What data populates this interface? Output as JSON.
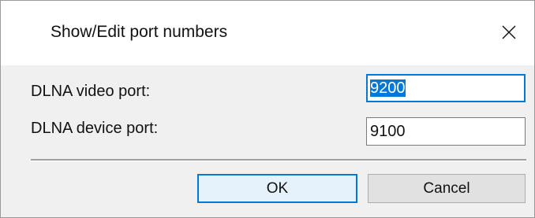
{
  "dialog": {
    "title": "Show/Edit port numbers",
    "close_icon": "close-icon"
  },
  "fields": {
    "video_port": {
      "label": "DLNA video port:",
      "value": "9200"
    },
    "device_port": {
      "label": "DLNA device port:",
      "value": "9100"
    }
  },
  "buttons": {
    "ok_label": "OK",
    "cancel_label": "Cancel"
  },
  "colors": {
    "accent": "#0078d7",
    "content_bg": "#f0f0f0",
    "button_bg": "#e1e1e1"
  }
}
